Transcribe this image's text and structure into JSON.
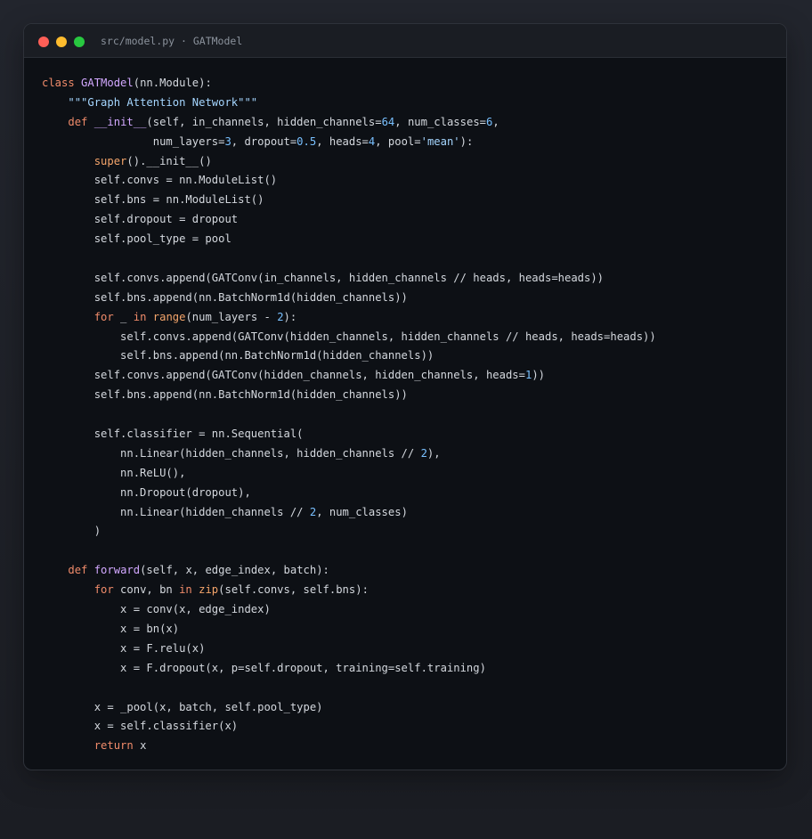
{
  "window": {
    "title": "src/model.py · GATModel"
  },
  "colors": {
    "keyword": "#f08b6a",
    "class_name": "#d2a8ff",
    "function_name": "#d2a8ff",
    "builtin": "#f5a56b",
    "number": "#79c0ff",
    "string": "#a5d6ff",
    "text": "#d4d8de",
    "background": "#0d1015"
  },
  "code_lines": [
    [
      {
        "t": "class ",
        "c": "kw"
      },
      {
        "t": "GATModel",
        "c": "cls"
      },
      {
        "t": "(nn.Module):",
        "c": "plain"
      }
    ],
    [
      {
        "t": "    ",
        "c": "plain"
      },
      {
        "t": "\"\"\"Graph Attention Network\"\"\"",
        "c": "str"
      }
    ],
    [
      {
        "t": "    ",
        "c": "plain"
      },
      {
        "t": "def ",
        "c": "kw"
      },
      {
        "t": "__init__",
        "c": "fn"
      },
      {
        "t": "(self, in_channels, hidden_channels=",
        "c": "plain"
      },
      {
        "t": "64",
        "c": "num"
      },
      {
        "t": ", num_classes=",
        "c": "plain"
      },
      {
        "t": "6",
        "c": "num"
      },
      {
        "t": ",",
        "c": "plain"
      }
    ],
    [
      {
        "t": "                 num_layers=",
        "c": "plain"
      },
      {
        "t": "3",
        "c": "num"
      },
      {
        "t": ", dropout=",
        "c": "plain"
      },
      {
        "t": "0.5",
        "c": "num"
      },
      {
        "t": ", heads=",
        "c": "plain"
      },
      {
        "t": "4",
        "c": "num"
      },
      {
        "t": ", pool=",
        "c": "plain"
      },
      {
        "t": "'mean'",
        "c": "str"
      },
      {
        "t": "):",
        "c": "plain"
      }
    ],
    [
      {
        "t": "        ",
        "c": "plain"
      },
      {
        "t": "super",
        "c": "bi"
      },
      {
        "t": "().__init__()",
        "c": "plain"
      }
    ],
    [
      {
        "t": "        self.convs = nn.ModuleList()",
        "c": "plain"
      }
    ],
    [
      {
        "t": "        self.bns = nn.ModuleList()",
        "c": "plain"
      }
    ],
    [
      {
        "t": "        self.dropout = dropout",
        "c": "plain"
      }
    ],
    [
      {
        "t": "        self.pool_type = pool",
        "c": "plain"
      }
    ],
    [
      {
        "t": "",
        "c": "plain"
      }
    ],
    [
      {
        "t": "        self.convs.append(GATConv(in_channels, hidden_channels // heads, heads=heads))",
        "c": "plain"
      }
    ],
    [
      {
        "t": "        self.bns.append(nn.BatchNorm1d(hidden_channels))",
        "c": "plain"
      }
    ],
    [
      {
        "t": "        ",
        "c": "plain"
      },
      {
        "t": "for",
        "c": "kw"
      },
      {
        "t": " _ ",
        "c": "plain"
      },
      {
        "t": "in",
        "c": "kw"
      },
      {
        "t": " ",
        "c": "plain"
      },
      {
        "t": "range",
        "c": "bi"
      },
      {
        "t": "(num_layers - ",
        "c": "plain"
      },
      {
        "t": "2",
        "c": "num"
      },
      {
        "t": "):",
        "c": "plain"
      }
    ],
    [
      {
        "t": "            self.convs.append(GATConv(hidden_channels, hidden_channels // heads, heads=heads))",
        "c": "plain"
      }
    ],
    [
      {
        "t": "            self.bns.append(nn.BatchNorm1d(hidden_channels))",
        "c": "plain"
      }
    ],
    [
      {
        "t": "        self.convs.append(GATConv(hidden_channels, hidden_channels, heads=",
        "c": "plain"
      },
      {
        "t": "1",
        "c": "num"
      },
      {
        "t": "))",
        "c": "plain"
      }
    ],
    [
      {
        "t": "        self.bns.append(nn.BatchNorm1d(hidden_channels))",
        "c": "plain"
      }
    ],
    [
      {
        "t": "",
        "c": "plain"
      }
    ],
    [
      {
        "t": "        self.classifier = nn.Sequential(",
        "c": "plain"
      }
    ],
    [
      {
        "t": "            nn.Linear(hidden_channels, hidden_channels // ",
        "c": "plain"
      },
      {
        "t": "2",
        "c": "num"
      },
      {
        "t": "),",
        "c": "plain"
      }
    ],
    [
      {
        "t": "            nn.ReLU(),",
        "c": "plain"
      }
    ],
    [
      {
        "t": "            nn.Dropout(dropout),",
        "c": "plain"
      }
    ],
    [
      {
        "t": "            nn.Linear(hidden_channels // ",
        "c": "plain"
      },
      {
        "t": "2",
        "c": "num"
      },
      {
        "t": ", num_classes)",
        "c": "plain"
      }
    ],
    [
      {
        "t": "        )",
        "c": "plain"
      }
    ],
    [
      {
        "t": "",
        "c": "plain"
      }
    ],
    [
      {
        "t": "    ",
        "c": "plain"
      },
      {
        "t": "def ",
        "c": "kw"
      },
      {
        "t": "forward",
        "c": "fn"
      },
      {
        "t": "(self, x, edge_index, batch):",
        "c": "plain"
      }
    ],
    [
      {
        "t": "        ",
        "c": "plain"
      },
      {
        "t": "for",
        "c": "kw"
      },
      {
        "t": " conv, bn ",
        "c": "plain"
      },
      {
        "t": "in",
        "c": "kw"
      },
      {
        "t": " ",
        "c": "plain"
      },
      {
        "t": "zip",
        "c": "bi"
      },
      {
        "t": "(self.convs, self.bns):",
        "c": "plain"
      }
    ],
    [
      {
        "t": "            x = conv(x, edge_index)",
        "c": "plain"
      }
    ],
    [
      {
        "t": "            x = bn(x)",
        "c": "plain"
      }
    ],
    [
      {
        "t": "            x = F.relu(x)",
        "c": "plain"
      }
    ],
    [
      {
        "t": "            x = F.dropout(x, p=self.dropout, training=self.training)",
        "c": "plain"
      }
    ],
    [
      {
        "t": "",
        "c": "plain"
      }
    ],
    [
      {
        "t": "        x = _pool(x, batch, self.pool_type)",
        "c": "plain"
      }
    ],
    [
      {
        "t": "        x = self.classifier(x)",
        "c": "plain"
      }
    ],
    [
      {
        "t": "        ",
        "c": "plain"
      },
      {
        "t": "return",
        "c": "kw"
      },
      {
        "t": " x",
        "c": "plain"
      }
    ]
  ]
}
